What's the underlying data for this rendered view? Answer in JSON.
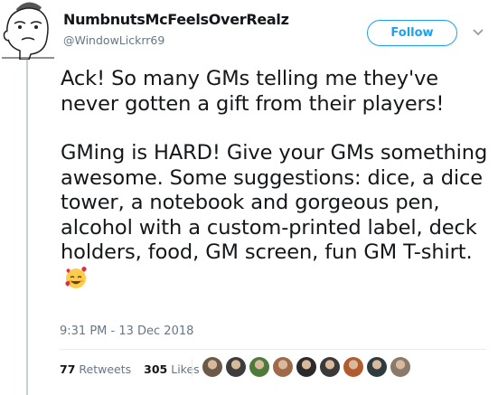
{
  "tweet": {
    "display_name": "NumbnutsMcFeelsOverRealz",
    "handle": "@WindowLickrr69",
    "follow_label": "Follow",
    "paragraphs": [
      "Ack! So many GMs telling me they've never gotten a gift from their players!",
      "GMing is HARD! Give your GMs something awesome. Some suggestions: dice, a dice tower, a notebook and gorgeous pen, alcohol with a custom-printed label, deck holders, food, GM screen, fun GM T-shirt."
    ],
    "emoji": "smiling-face-with-hearts",
    "timestamp": "9:31 PM - 13 Dec 2018",
    "retweets_count": "77",
    "retweets_label": "Retweets",
    "likes_count": "305",
    "likes_label": "Likes"
  },
  "colors": {
    "accent": "#1da1f2",
    "muted": "#657786",
    "text": "#14171a",
    "divider": "#e6ecf0"
  },
  "liker_avatars": [
    {
      "name": "liker-avatar-1",
      "color": "#6b5a4a"
    },
    {
      "name": "liker-avatar-2",
      "color": "#3d3d3d"
    },
    {
      "name": "liker-avatar-3",
      "color": "#4e7a3a"
    },
    {
      "name": "liker-avatar-4",
      "color": "#a06a4a"
    },
    {
      "name": "liker-avatar-5",
      "color": "#2b2b2b"
    },
    {
      "name": "liker-avatar-6",
      "color": "#3a3a3a"
    },
    {
      "name": "liker-avatar-7",
      "color": "#b25c2e"
    },
    {
      "name": "liker-avatar-8",
      "color": "#2f3b3f"
    },
    {
      "name": "liker-avatar-9",
      "color": "#8a7a6a"
    }
  ]
}
